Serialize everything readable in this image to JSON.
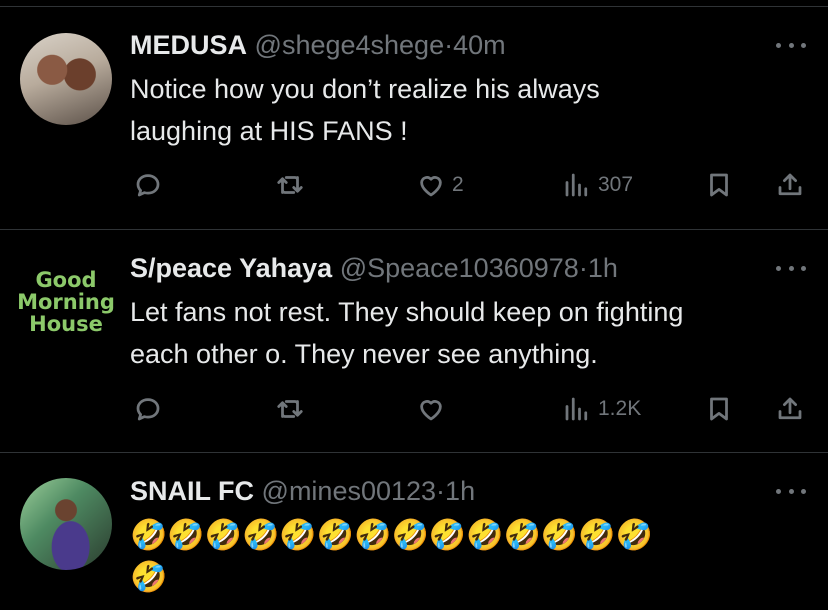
{
  "tweets": [
    {
      "name": "MEDUSA",
      "handle": "@shege4shege",
      "dot": "·",
      "time": "40m",
      "text_lines": [
        "Notice how you don’t realize his always",
        "laughing at HIS FANS !"
      ],
      "likes": "2",
      "views": "307"
    },
    {
      "name": "S/peace Yahaya",
      "handle": "@Speace10360978",
      "dot": "·",
      "time": "1h",
      "avatar_text": [
        "Good",
        "Morning",
        "House"
      ],
      "text_lines": [
        "Let fans not rest. They should keep on fighting",
        "each other o. They never see anything."
      ],
      "likes": "",
      "views": "1.2K"
    },
    {
      "name": "SNAIL FC",
      "handle": "@mines00123",
      "dot": "·",
      "time": "1h",
      "emoji_line1": "🤣🤣🤣🤣🤣🤣🤣🤣🤣🤣🤣🤣🤣🤣",
      "emoji_line2": "🤣"
    }
  ],
  "icons": {
    "reply": "reply-bubble-icon",
    "retweet": "retweet-icon",
    "like": "heart-icon",
    "views": "views-bar-chart-icon",
    "bookmark": "bookmark-icon",
    "share": "share-icon",
    "more": "more-dots-icon"
  },
  "colors": {
    "background": "#000000",
    "text": "#e7e9ea",
    "muted": "#71767b",
    "divider": "#2f3336",
    "avatar_logo_text": "#8cc96a"
  }
}
